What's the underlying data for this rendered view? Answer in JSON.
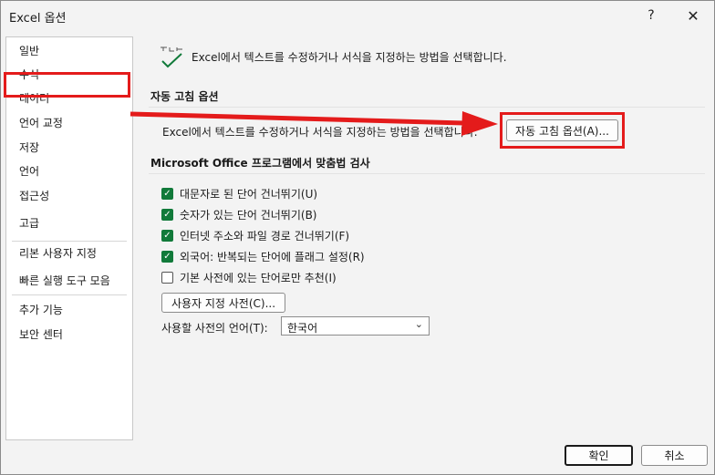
{
  "window": {
    "title": "Excel 옵션",
    "help_glyph": "?",
    "close_glyph": "✕"
  },
  "sidebar": {
    "items": [
      {
        "label": "일반"
      },
      {
        "label": "수식"
      },
      {
        "label": "데이터"
      },
      {
        "label": "언어 교정",
        "selected": true
      },
      {
        "label": "저장"
      },
      {
        "label": "언어"
      },
      {
        "label": "접근성"
      },
      {
        "label": "고급"
      },
      {
        "label": "리본 사용자 지정"
      },
      {
        "label": "빠른 실행 도구 모음"
      },
      {
        "label": "추가 기능"
      },
      {
        "label": "보안 센터"
      }
    ]
  },
  "main": {
    "header_text": "Excel에서 텍스트를 수정하거나 서식을 지정하는 방법을 선택합니다.",
    "autocorrect_section": {
      "title": "자동 고침 옵션",
      "description": "Excel에서 텍스트를 수정하거나 서식을 지정하는 방법을 선택합니다.",
      "button_label": "자동 고침 옵션(A)..."
    },
    "spelling_section": {
      "title": "Microsoft Office 프로그램에서 맞춤법 검사",
      "options": [
        {
          "label": "대문자로 된 단어 건너뛰기(U)",
          "checked": true
        },
        {
          "label": "숫자가 있는 단어 건너뛰기(B)",
          "checked": true
        },
        {
          "label": "인터넷 주소와 파일 경로 건너뛰기(F)",
          "checked": true
        },
        {
          "label": "외국어: 반복되는 단어에 플래그 설정(R)",
          "checked": true
        },
        {
          "label": "기본 사전에 있는 단어로만 추천(I)",
          "checked": false
        }
      ],
      "custom_dict_button": "사용자 지정 사전(C)...",
      "dict_language_label": "사용할 사전의 언어(T):",
      "dict_language_value": "한국어"
    }
  },
  "footer": {
    "ok_label": "확인",
    "cancel_label": "취소"
  },
  "colors": {
    "highlight": "#e41b1b",
    "checkbox_on": "#117a3a"
  }
}
